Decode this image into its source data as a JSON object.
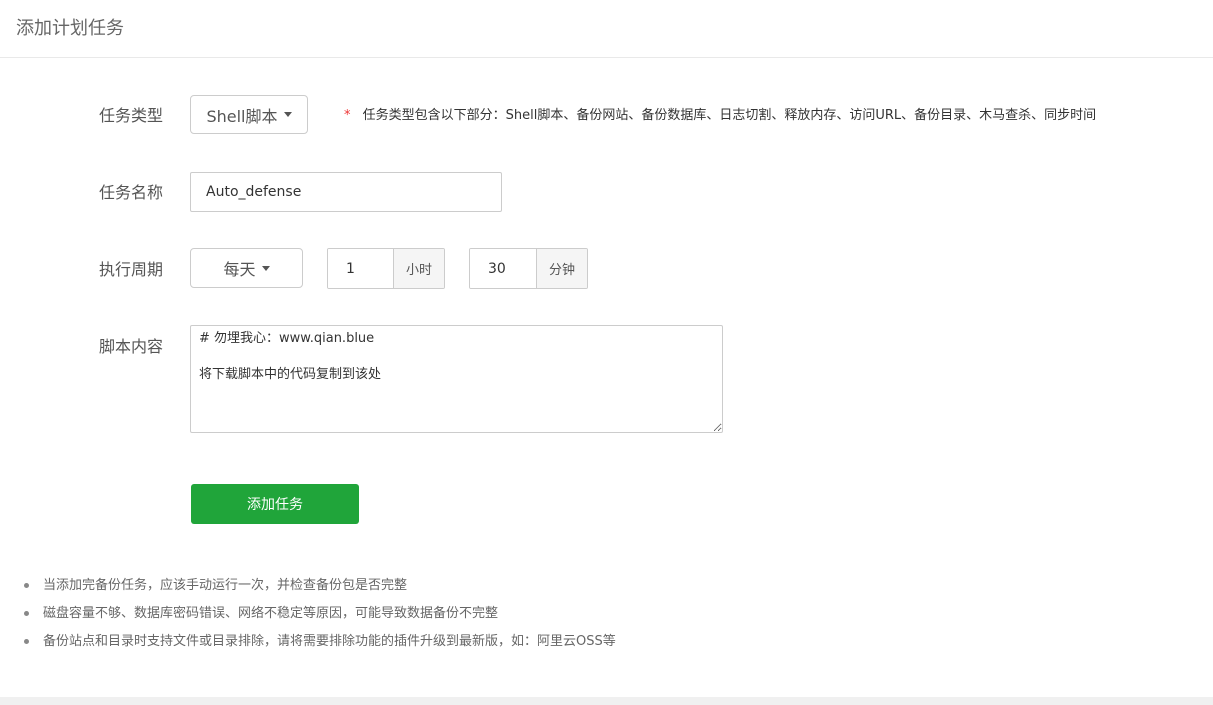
{
  "header": {
    "title": "添加计划任务"
  },
  "form": {
    "task_type": {
      "label": "任务类型",
      "value": "Shell脚本",
      "hint_star": "*",
      "hint": "任务类型包含以下部分：Shell脚本、备份网站、备份数据库、日志切割、释放内存、访问URL、备份目录、木马查杀、同步时间"
    },
    "task_name": {
      "label": "任务名称",
      "value": "Auto_defense"
    },
    "cycle": {
      "label": "执行周期",
      "value": "每天",
      "hour_value": "1",
      "hour_unit": "小时",
      "minute_value": "30",
      "minute_unit": "分钟"
    },
    "script": {
      "label": "脚本内容",
      "content": "# 勿埋我心：www.qian.blue\n\n将下载脚本中的代码复制到该处"
    },
    "submit_label": "添加任务"
  },
  "notes": [
    "当添加完备份任务，应该手动运行一次，并检查备份包是否完整",
    "磁盘容量不够、数据库密码错误、网络不稳定等原因，可能导致数据备份不完整",
    "备份站点和目录时支持文件或目录排除，请将需要排除功能的插件升级到最新版，如：阿里云OSS等"
  ],
  "colors": {
    "accent": "#20a53a",
    "required_star": "#ee3333"
  }
}
